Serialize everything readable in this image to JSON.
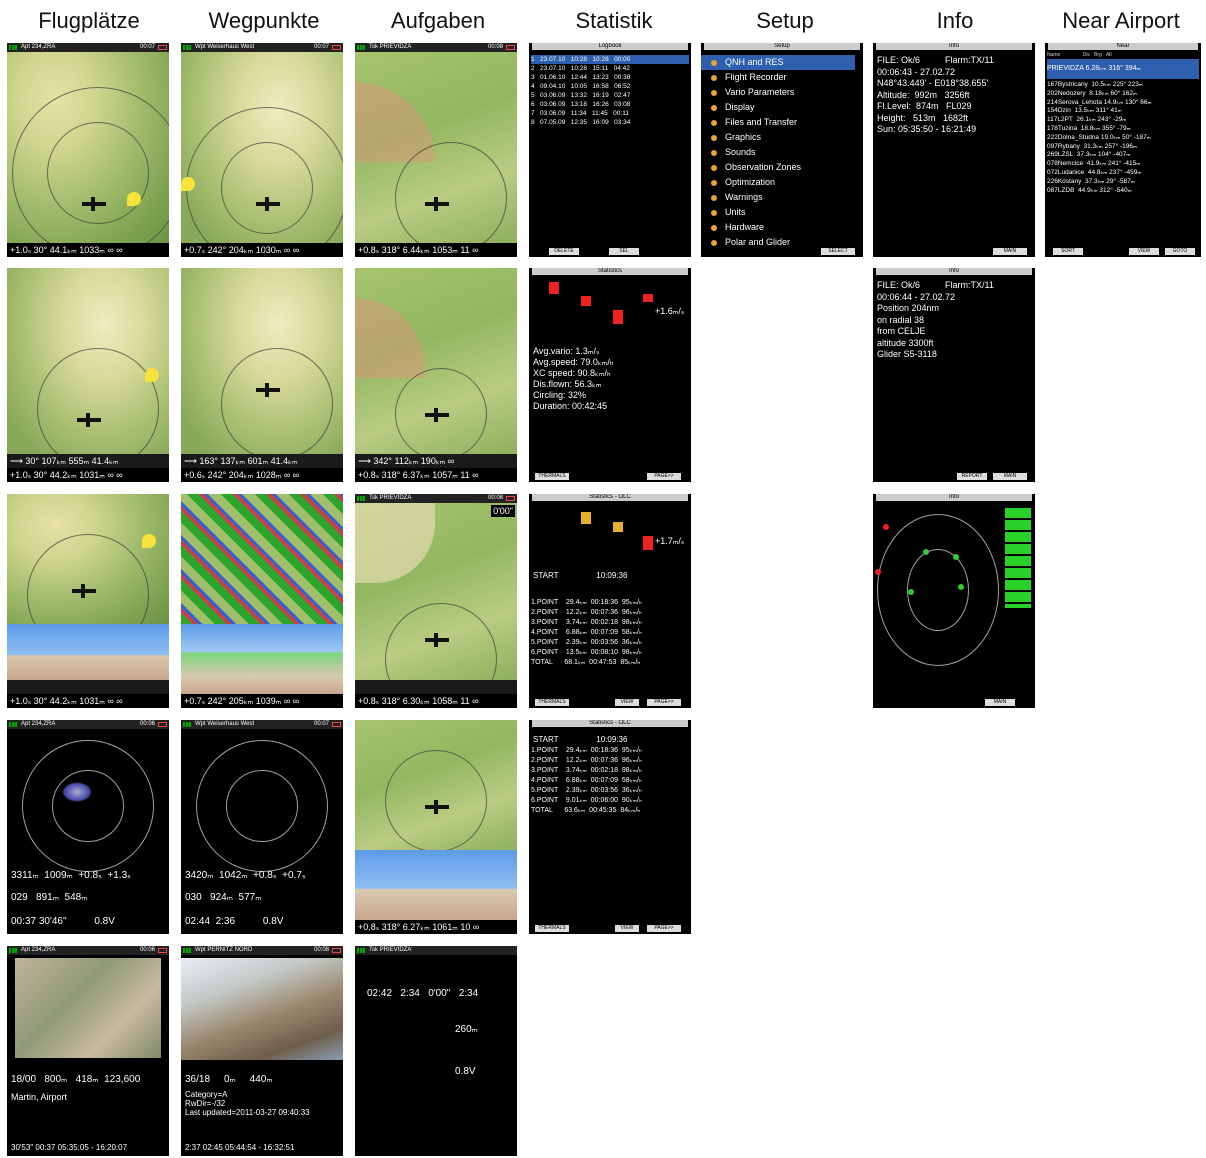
{
  "headers": [
    "Flugplätze",
    "Wegpunkte",
    "Aufgaben",
    "Statistik",
    "Setup",
    "Info",
    "Near Airport"
  ],
  "status": {
    "apt": "Apt 234,ZRA",
    "wpt": "Wpt Weiserhaus West",
    "wpt2": "Wpt PERNITZ NORD",
    "tsk": "Tsk PRIEVIDZA",
    "t07": "00:07",
    "t06": "00:06",
    "t08": "00:08"
  },
  "bars": {
    "apt": "+1.0ₛ 30° 44.1ₖₘ 1033ₘ ∞ ∞",
    "apt_b": "+1.0ₛ 30° 44.2ₖₘ 1031ₘ ∞ ∞",
    "apt_top": "⟶ 30° 107ₖₘ 555ₘ 41.4ₖₘ",
    "wpt": "+0.7ₛ 242° 204ₖₘ 1030ₘ ∞ ∞",
    "wpt_b": "+0.6ₛ 242° 204ₖₘ 1028ₘ ∞ ∞",
    "wpt_top": "⟶ 163° 137ₖₘ 601ₘ 41.4ₖₘ",
    "wpt_c": "+0.7ₛ 242° 205ₖₘ 1039ₘ ∞ ∞",
    "tsk": "+0.8ₛ 318° 6.44ₖₘ 1053ₘ 11 ∞",
    "tsk_b": "+0.8ₛ 318° 6.37ₖₘ 1057ₘ 11 ∞",
    "tsk_top": "⟶ 342° 112ₖₘ 190ₖₘ ∞",
    "tsk_c": "+0.8ₛ 318° 6.30ₖₘ 1058ₘ 11 ∞",
    "tsk_d": "+0.8ₛ 318° 6.27ₖₘ 1061ₘ 10 ∞"
  },
  "logbook": {
    "title": "Logbook",
    "rows": [
      [
        "1",
        "23.07.10",
        "10:28",
        "10:28",
        "00:00"
      ],
      [
        "2",
        "23.07.10",
        "10:28",
        "15:11",
        "04:42"
      ],
      [
        "3",
        "01.06.10",
        "12:44",
        "13:23",
        "00:38"
      ],
      [
        "4",
        "09.04.10",
        "10:05",
        "16:58",
        "06:52"
      ],
      [
        "5",
        "03.06.09",
        "13:32",
        "16:19",
        "02:47"
      ],
      [
        "6",
        "03.06.09",
        "13:18",
        "16:26",
        "03:08"
      ],
      [
        "7",
        "03.06.09",
        "11:34",
        "11:45",
        "00:11"
      ],
      [
        "8",
        "07.05.09",
        "12:35",
        "16:09",
        "03:34"
      ]
    ],
    "btn1": "DELETE",
    "btn2": "SEL"
  },
  "stats": {
    "title": "Statistics",
    "val": "+1.6ₘ/ₛ",
    "lines": [
      "Avg.vario: 1.3ₘ/ₛ",
      "Avg.speed: 79.0ₖₘ/ₕ",
      "XC speed: 90.8ₖₘ/ₕ",
      "Dis.flown: 56.3ₖₘ",
      "Circling: 32%",
      "Duration: 00:42:45"
    ],
    "btn1": "THERMALS",
    "btn2": "PAGE>>"
  },
  "olc": {
    "title": "Statistics - OLC",
    "val": "+1.7ₘ/ₛ",
    "start": "START",
    "start_time": "10:09:36",
    "rows": [
      [
        "1.POINT",
        "29.4ₖₘ",
        "00:18:36",
        "95ₖₘ/ₕ"
      ],
      [
        "2.POINT",
        "12.2ₖₘ",
        "00:07:36",
        "96ₖₘ/ₕ"
      ],
      [
        "3.POINT",
        "3.74ₖₘ",
        "00:02:18",
        "98ₖₘ/ₕ"
      ],
      [
        "4.POINT",
        "6.88ₖₘ",
        "00:07:09",
        "58ₖₘ/ₕ"
      ],
      [
        "5.POINT",
        "2.39ₖₘ",
        "00:03:56",
        "36ₖₘ/ₕ"
      ],
      [
        "6.POINT",
        "13.5ₖₘ",
        "00:08:10",
        "98ₖₘ/ₕ"
      ]
    ],
    "total": [
      "TOTAL",
      "68.1ₖₘ",
      "00:47:53",
      "85ₖₘ/ₕ"
    ],
    "rows2_last": [
      "6.POINT",
      "9.01ₖₘ",
      "00:06:00",
      "90ₖₘ/ₕ"
    ],
    "total2": [
      "TOTAL",
      "63.6ₖₘ",
      "00:45:35",
      "84ₖₘ/ₕ"
    ],
    "btn1": "THERMALS",
    "btn2": "VIEW",
    "btn3": "PAGE>>"
  },
  "setup": {
    "title": "Setup",
    "items": [
      "QNH and RES",
      "Flight Recorder",
      "Vario Parameters",
      "Display",
      "Files and Transfer",
      "Graphics",
      "Sounds",
      "Observation Zones",
      "Optimization",
      "Warnings",
      "Units",
      "Hardware",
      "Polar and Glider"
    ],
    "btn": "SELECT"
  },
  "info1": {
    "title": "Info",
    "lines": [
      "FILE: Ok/6          Flarm:TX/11",
      "00:06:43 - 27.02.72",
      "N48°43.449' - E018°38.655'",
      "Altitude:  992m   3256ft",
      "Fl.Level:  874m   FL029",
      "Height:   513m   1682ft",
      "Sun: 05:35:50 - 16:21:49"
    ],
    "btn": "MAIN"
  },
  "info2": {
    "lines": [
      "FILE: Ok/6          Flarm:TX/11",
      "00:06:44 - 27.02.72",
      "Position 204nm",
      "on radial 38",
      "from CELJE",
      "altitude 3300ft",
      "Glider S5-3118"
    ],
    "btn1": "REPORT",
    "btn2": "MAIN"
  },
  "near": {
    "title": "Near",
    "hdr": [
      "Name",
      "Dis",
      "Brg",
      "Alt"
    ],
    "first": "PRIEVIDZA  6.28ₖₘ 316° 394ₘ",
    "rows": [
      "167Bystricany  10.5ₖₘ 225° 223ₘ",
      "202Nedozery  8.18ₖₘ 60° 162ₘ",
      "214Serova_Lehota 14.9ₖₘ 130° 66ₘ",
      "154Dzin  13.5ₖₘ 311° 41ₘ",
      "117L2PT  26.1ₖₘ 243° -29ₘ",
      "178Tuzina  18.8ₖₘ 355° -79ₘ",
      "222Dolna_Studna 19.0ₖₘ 50° -187ₘ",
      "097Rybany  31.3ₖₘ 257° -196ₘ",
      "269LZSL  37.3ₖₘ 104° -407ₘ",
      "078Nemcice  41.9ₖₘ 241° -415ₘ",
      "072Ludanice  44.8ₖₘ 237° -459ₘ",
      "226Kostany  37.3ₖₘ 29° -587ₘ",
      "087LZDB  44.9ₖₘ 312° -540ₘ"
    ],
    "btn1": "SORT",
    "btn2": "VIEW",
    "btn3": "GOTO"
  },
  "thermal": {
    "apt": [
      "3311ₘ",
      "1009ₘ",
      "+0.8ₛ",
      "+1.3ₛ",
      "029",
      "891ₘ",
      "548ₘ",
      "00:37",
      "30'46\"",
      "0.8V"
    ],
    "wpt": [
      "3420ₘ",
      "1042ₘ",
      "+0.8ₛ",
      "+0.7ₛ",
      "030",
      "924ₘ",
      "577ₘ",
      "02:44",
      "2:36",
      "0.8V"
    ]
  },
  "photo": {
    "apt": [
      "18/00",
      "800ₘ",
      "418ₘ",
      "123,600",
      "Martin, Airport",
      "30'53\"  00:37  05:35:05 - 16:20:07"
    ],
    "wpt": [
      "36/18",
      "0ₘ",
      "440ₘ",
      "Category=A",
      "RwDir=-/32",
      "Last updated=2011-03-27 09:40:33",
      "2:37  02:45  05:44:54 - 16:32:51"
    ]
  },
  "tskinfo": [
    "02:42",
    "2:34",
    "0'00\"",
    "2:34",
    "260ₘ",
    "0.8V"
  ],
  "olc_time": "0'00\""
}
